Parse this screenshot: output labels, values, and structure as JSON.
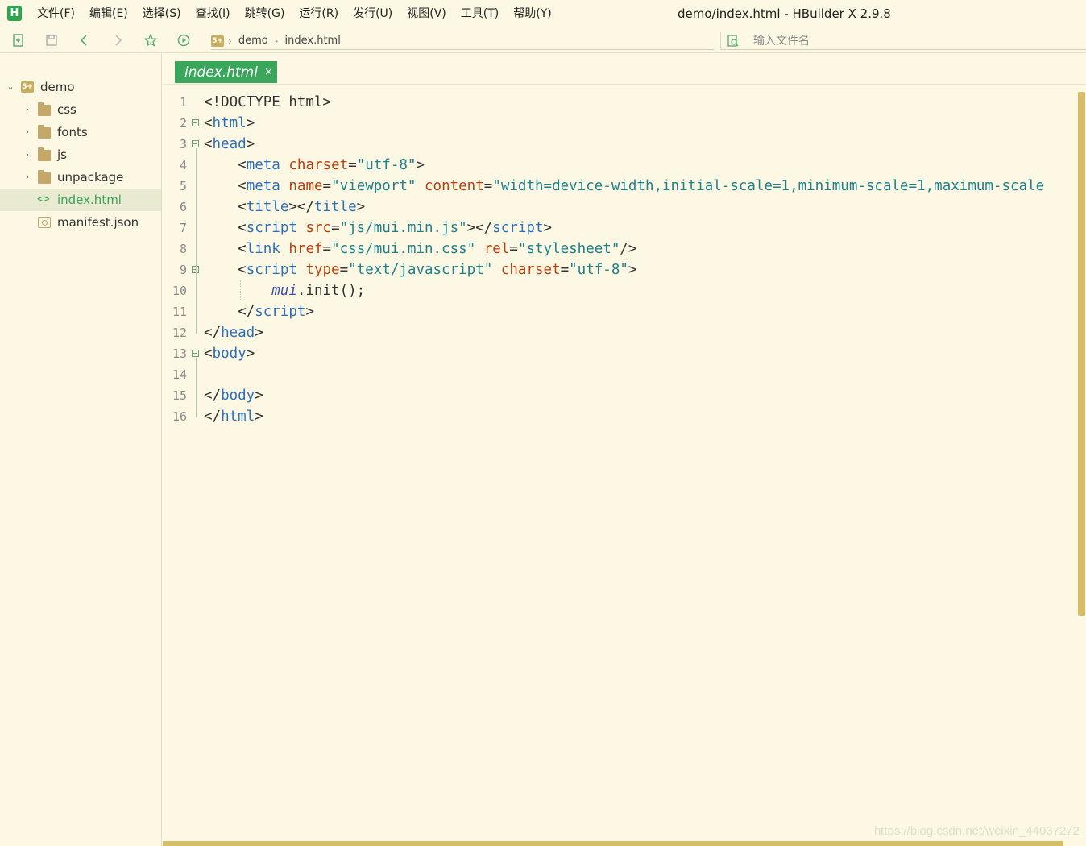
{
  "app": {
    "logo_letter": "H",
    "window_title": "demo/index.html - HBuilder X 2.9.8"
  },
  "menu": [
    {
      "label": "文件(F)"
    },
    {
      "label": "编辑(E)"
    },
    {
      "label": "选择(S)"
    },
    {
      "label": "查找(I)"
    },
    {
      "label": "跳转(G)"
    },
    {
      "label": "运行(R)"
    },
    {
      "label": "发行(U)"
    },
    {
      "label": "视图(V)"
    },
    {
      "label": "工具(T)"
    },
    {
      "label": "帮助(Y)"
    }
  ],
  "toolbar": {
    "icons": [
      "new-file-icon",
      "save-icon",
      "back-icon",
      "forward-icon",
      "favorite-star-icon",
      "run-icon"
    ],
    "breadcrumb": {
      "logo": "5+",
      "items": [
        "demo",
        "index.html"
      ]
    },
    "file_search_placeholder": "输入文件名"
  },
  "sidebar": {
    "project": {
      "name": "demo",
      "logo": "5+",
      "expanded": true
    },
    "items": [
      {
        "label": "css",
        "type": "folder"
      },
      {
        "label": "fonts",
        "type": "folder"
      },
      {
        "label": "js",
        "type": "folder"
      },
      {
        "label": "unpackage",
        "type": "folder"
      },
      {
        "label": "index.html",
        "type": "html",
        "selected": true,
        "icon_glyph": "<>"
      },
      {
        "label": "manifest.json",
        "type": "json"
      }
    ]
  },
  "editor": {
    "tab": {
      "label": "index.html",
      "close_glyph": "×"
    },
    "line_numbers": [
      "1",
      "2",
      "3",
      "4",
      "5",
      "6",
      "7",
      "8",
      "9",
      "10",
      "11",
      "12",
      "13",
      "14",
      "15",
      "16"
    ],
    "lines": [
      [
        {
          "t": "<!DOCTYPE html>",
          "c": "pun"
        }
      ],
      [
        {
          "t": "<",
          "c": "pun"
        },
        {
          "t": "html",
          "c": "tag"
        },
        {
          "t": ">",
          "c": "pun"
        }
      ],
      [
        {
          "t": "<",
          "c": "pun"
        },
        {
          "t": "head",
          "c": "tag"
        },
        {
          "t": ">",
          "c": "pun"
        }
      ],
      [
        {
          "t": "    <",
          "c": "pun"
        },
        {
          "t": "meta",
          "c": "tag"
        },
        {
          "t": " ",
          "c": "pun"
        },
        {
          "t": "charset",
          "c": "att"
        },
        {
          "t": "=",
          "c": "pun"
        },
        {
          "t": "\"utf-8\"",
          "c": "str"
        },
        {
          "t": ">",
          "c": "pun"
        }
      ],
      [
        {
          "t": "    <",
          "c": "pun"
        },
        {
          "t": "meta",
          "c": "tag"
        },
        {
          "t": " ",
          "c": "pun"
        },
        {
          "t": "name",
          "c": "att"
        },
        {
          "t": "=",
          "c": "pun"
        },
        {
          "t": "\"viewport\"",
          "c": "str"
        },
        {
          "t": " ",
          "c": "pun"
        },
        {
          "t": "content",
          "c": "att"
        },
        {
          "t": "=",
          "c": "pun"
        },
        {
          "t": "\"width=device-width,initial-scale=1,minimum-scale=1,maximum-scale",
          "c": "str"
        }
      ],
      [
        {
          "t": "    <",
          "c": "pun"
        },
        {
          "t": "title",
          "c": "tag"
        },
        {
          "t": "></",
          "c": "pun"
        },
        {
          "t": "title",
          "c": "tag"
        },
        {
          "t": ">",
          "c": "pun"
        }
      ],
      [
        {
          "t": "    <",
          "c": "pun"
        },
        {
          "t": "script",
          "c": "tag"
        },
        {
          "t": " ",
          "c": "pun"
        },
        {
          "t": "src",
          "c": "att"
        },
        {
          "t": "=",
          "c": "pun"
        },
        {
          "t": "\"js/mui.min.js\"",
          "c": "str"
        },
        {
          "t": "></",
          "c": "pun"
        },
        {
          "t": "script",
          "c": "tag"
        },
        {
          "t": ">",
          "c": "pun"
        }
      ],
      [
        {
          "t": "    <",
          "c": "pun"
        },
        {
          "t": "link",
          "c": "tag"
        },
        {
          "t": " ",
          "c": "pun"
        },
        {
          "t": "href",
          "c": "att"
        },
        {
          "t": "=",
          "c": "pun"
        },
        {
          "t": "\"css/mui.min.css\"",
          "c": "str"
        },
        {
          "t": " ",
          "c": "pun"
        },
        {
          "t": "rel",
          "c": "att"
        },
        {
          "t": "=",
          "c": "pun"
        },
        {
          "t": "\"stylesheet\"",
          "c": "str"
        },
        {
          "t": "/>",
          "c": "pun"
        }
      ],
      [
        {
          "t": "    <",
          "c": "pun"
        },
        {
          "t": "script",
          "c": "tag"
        },
        {
          "t": " ",
          "c": "pun"
        },
        {
          "t": "type",
          "c": "att"
        },
        {
          "t": "=",
          "c": "pun"
        },
        {
          "t": "\"text/javascript\"",
          "c": "str"
        },
        {
          "t": " ",
          "c": "pun"
        },
        {
          "t": "charset",
          "c": "att"
        },
        {
          "t": "=",
          "c": "pun"
        },
        {
          "t": "\"utf-8\"",
          "c": "str"
        },
        {
          "t": ">",
          "c": "pun"
        }
      ],
      [
        {
          "t": "        ",
          "c": "pun"
        },
        {
          "t": "mui",
          "c": "js-obj"
        },
        {
          "t": ".init();",
          "c": "js-fn"
        }
      ],
      [
        {
          "t": "    </",
          "c": "pun"
        },
        {
          "t": "script",
          "c": "tag"
        },
        {
          "t": ">",
          "c": "pun"
        }
      ],
      [
        {
          "t": "</",
          "c": "pun"
        },
        {
          "t": "head",
          "c": "tag"
        },
        {
          "t": ">",
          "c": "pun"
        }
      ],
      [
        {
          "t": "<",
          "c": "pun"
        },
        {
          "t": "body",
          "c": "tag"
        },
        {
          "t": ">",
          "c": "pun"
        }
      ],
      [
        {
          "t": "",
          "c": "pun"
        }
      ],
      [
        {
          "t": "</",
          "c": "pun"
        },
        {
          "t": "body",
          "c": "tag"
        },
        {
          "t": ">",
          "c": "pun"
        }
      ],
      [
        {
          "t": "</",
          "c": "pun"
        },
        {
          "t": "html",
          "c": "tag"
        },
        {
          "t": ">",
          "c": "pun"
        }
      ]
    ],
    "fold_markers": [
      2,
      3,
      9,
      13
    ]
  },
  "watermark": "https://blog.csdn.net/weixin_44037272",
  "colors": {
    "background": "#fdf8e3",
    "accent_green": "#3ba55c",
    "scrollbar": "#d8bd69",
    "tag": "#2c6fb8",
    "attribute": "#b7410e",
    "string": "#1f7f8a"
  }
}
